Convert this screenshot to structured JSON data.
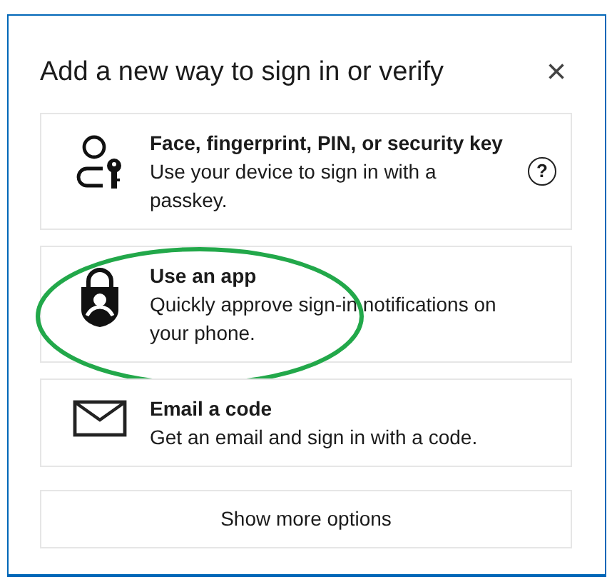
{
  "dialog": {
    "title": "Add a new way to sign in or verify",
    "close": "×"
  },
  "options": [
    {
      "kind": "passkey",
      "title": "Face, fingerprint, PIN, or security key",
      "description": "Use your device to sign in with a passkey.",
      "help": "?",
      "highlighted": false
    },
    {
      "kind": "app",
      "title": "Use an app",
      "description": "Quickly approve sign-in notifications on your phone.",
      "highlighted": true
    },
    {
      "kind": "email",
      "title": "Email a code",
      "description": "Get an email and sign in with a code.",
      "highlighted": false
    }
  ],
  "more_button": "Show more options"
}
